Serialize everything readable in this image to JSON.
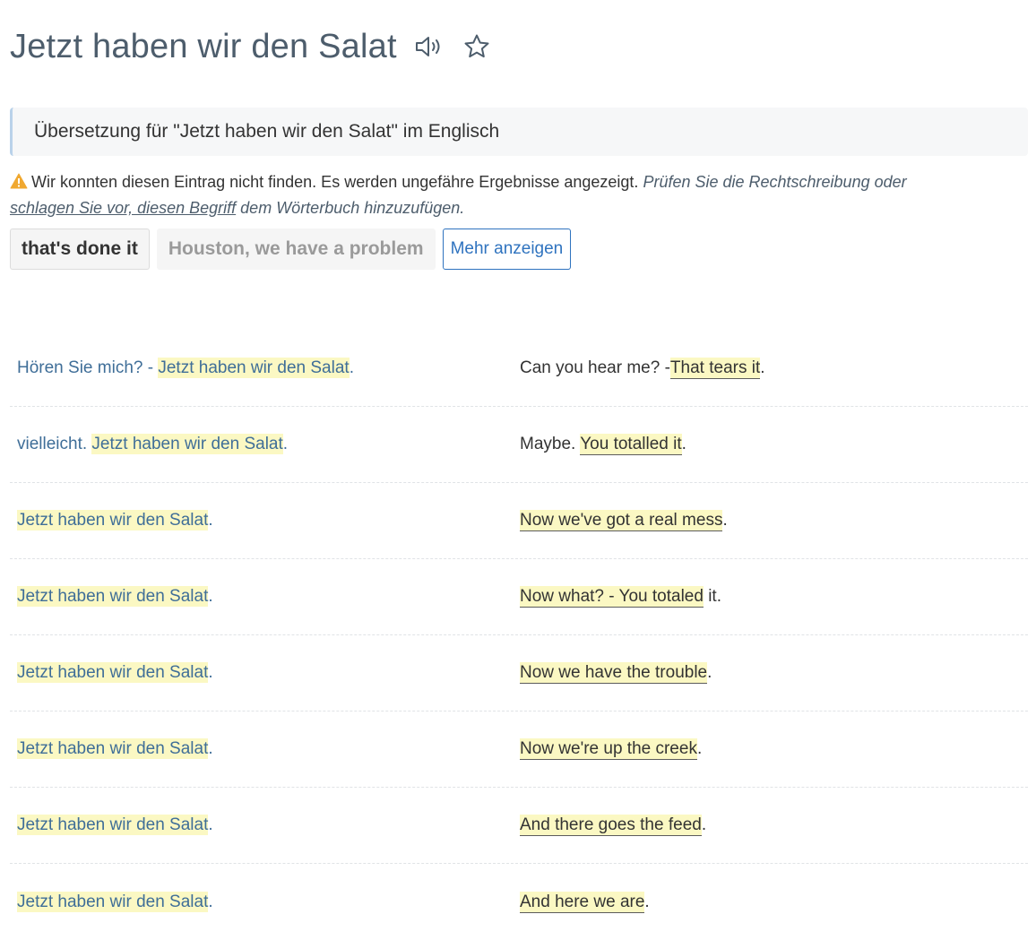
{
  "header": {
    "title": "Jetzt haben wir den Salat",
    "speaker_icon": "speaker-icon",
    "star_icon": "star-outline-icon"
  },
  "banner": {
    "text": "Übersetzung für \"Jetzt haben wir den Salat\" im Englisch"
  },
  "notice": {
    "icon": "warning-icon",
    "message": "Wir konnten diesen Eintrag nicht finden. Es werden ungefähre Ergebnisse angezeigt.",
    "hint_before": "Prüfen Sie die Rechtschreibung oder",
    "hint_link": "schlagen Sie vor, diesen Begriff",
    "hint_after": "dem Wörterbuch hinzuzufügen."
  },
  "translations": {
    "primary": "that's done it",
    "secondary": "Houston, we have a problem",
    "more_label": "Mehr anzeigen"
  },
  "examples": [
    {
      "src_pre": "Hören Sie mich? - ",
      "src_hl": "Jetzt haben wir den Salat",
      "src_post": ".",
      "tgt_pre": "Can you hear me? -",
      "tgt_hl": "That tears it",
      "tgt_post": "."
    },
    {
      "src_pre": "vielleicht. ",
      "src_hl": "Jetzt haben wir den Salat",
      "src_post": ".",
      "tgt_pre": "Maybe. ",
      "tgt_hl": "You totalled it",
      "tgt_post": "."
    },
    {
      "src_pre": "",
      "src_hl": "Jetzt haben wir den Salat",
      "src_post": ".",
      "tgt_pre": "",
      "tgt_hl": "Now we've got a real mess",
      "tgt_post": "."
    },
    {
      "src_pre": "",
      "src_hl": "Jetzt haben wir den Salat",
      "src_post": ".",
      "tgt_pre": "",
      "tgt_hl": "Now what? - You totaled",
      "tgt_post": " it."
    },
    {
      "src_pre": "",
      "src_hl": "Jetzt haben wir den Salat",
      "src_post": ".",
      "tgt_pre": "",
      "tgt_hl": "Now we have the trouble",
      "tgt_post": "."
    },
    {
      "src_pre": "",
      "src_hl": "Jetzt haben wir den Salat",
      "src_post": ".",
      "tgt_pre": "",
      "tgt_hl": "Now we're up the creek",
      "tgt_post": "."
    },
    {
      "src_pre": "",
      "src_hl": "Jetzt haben wir den Salat",
      "src_post": ".",
      "tgt_pre": "",
      "tgt_hl": "And there goes the feed",
      "tgt_post": "."
    },
    {
      "src_pre": "",
      "src_hl": "Jetzt haben wir den Salat",
      "src_post": ".",
      "tgt_pre": "",
      "tgt_hl": "And here we are",
      "tgt_post": "."
    }
  ]
}
